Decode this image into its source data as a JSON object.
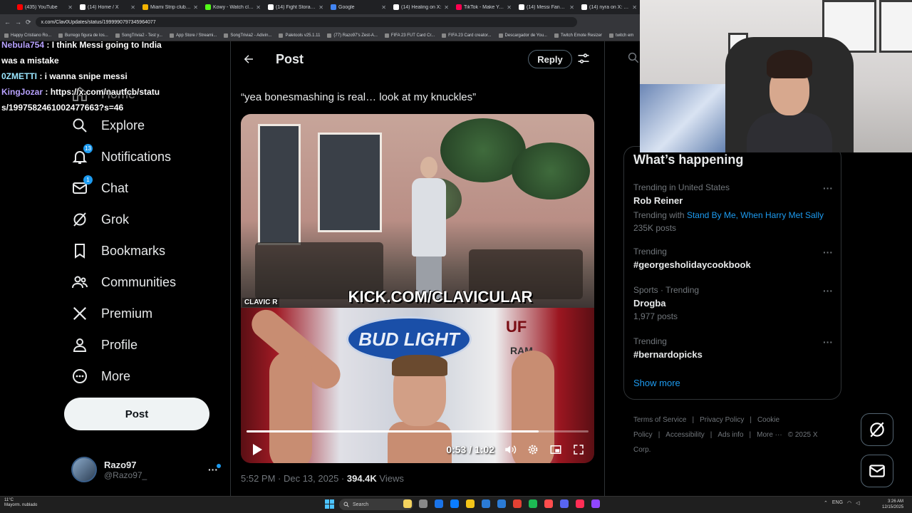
{
  "browser": {
    "tabs": [
      {
        "label": "(435) YouTube",
        "color": "#ff0000"
      },
      {
        "label": "(14) Home / X",
        "color": "#ffffff"
      },
      {
        "label": "Miami Strip clubs, U",
        "color": "#f4b400"
      },
      {
        "label": "Kowy - Watch clips",
        "color": "#53fc18"
      },
      {
        "label": "(14) Fight Storage o",
        "color": "#ffffff"
      },
      {
        "label": "Google",
        "color": "#4285f4"
      },
      {
        "label": "(14) Healing on X:",
        "color": "#ffffff"
      },
      {
        "label": "TikTok - Make Your",
        "color": "#ff0050"
      },
      {
        "label": "(14) Messi Fanatic o",
        "color": "#ffffff"
      },
      {
        "label": "(14) nyra on X: \"the",
        "color": "#ffffff"
      }
    ],
    "url": "x.com/Clav0Updates/status/1999990797345964077",
    "bookmarks": [
      "Happy Cristiano Ro...",
      "Burrego figura de los...",
      "SongTrivia2 - Test y...",
      "App Store / Streami...",
      "SongTrivia2 - Adivin...",
      "Paletools v25.1.11",
      "(77) Razo97's Zest-A...",
      "FIFA 23 FUT Card Cr...",
      "FIFA 23 Card creator...",
      "Descargador de You...",
      "Twitch Emote Resizer",
      "twitch em"
    ]
  },
  "chat": [
    {
      "user": "Nebula754",
      "text": ": I think Messi going to India was a mistake"
    },
    {
      "user": "0ZMETTI",
      "text": ": i wanna snipe messi"
    },
    {
      "user": "KingJozar",
      "text": ": https://x.com/nautfcb/status/1997582461002477663?s=46"
    }
  ],
  "sidebar": {
    "items": [
      {
        "label": "Home",
        "icon": "home-icon"
      },
      {
        "label": "Explore",
        "icon": "search-icon"
      },
      {
        "label": "Notifications",
        "icon": "bell-icon",
        "badge": "13"
      },
      {
        "label": "Chat",
        "icon": "mail-icon",
        "badge": "1"
      },
      {
        "label": "Grok",
        "icon": "grok-icon"
      },
      {
        "label": "Bookmarks",
        "icon": "bookmark-icon"
      },
      {
        "label": "Communities",
        "icon": "people-icon"
      },
      {
        "label": "Premium",
        "icon": "x-logo-icon"
      },
      {
        "label": "Profile",
        "icon": "person-icon"
      },
      {
        "label": "More",
        "icon": "more-circle-icon"
      }
    ],
    "post_label": "Post",
    "account": {
      "name": "Razo97",
      "handle": "@Razo97_"
    }
  },
  "post": {
    "header_title": "Post",
    "reply_label": "Reply",
    "text": "“yea bonesmashing is real… look at my knuckles”",
    "video": {
      "overlay_text": "KICK.COM/CLAVICULAR",
      "overlay_small": "CLAVIC    R",
      "banner_text": "BUD LIGHT",
      "banner_side": "UF",
      "banner_side2": "RAM",
      "time": "0:53 / 1:02",
      "progress": 0.855
    },
    "timestamp": "5:52 PM · Dec 13, 2025 · ",
    "views_count": "394.4K",
    "views_label": " Views"
  },
  "trending": {
    "title": "What’s happening",
    "items": [
      {
        "context": "Trending in United States",
        "name": "Rob Reiner",
        "with_label": "Trending with ",
        "with_links": "Stand By Me, When Harry Met Sally",
        "count": "235K posts"
      },
      {
        "context": "Trending",
        "name": "#georgesholidaycookbook"
      },
      {
        "context": "Sports · Trending",
        "name": "Drogba",
        "count": "1,977 posts"
      },
      {
        "context": "Trending",
        "name": "#bernardopicks"
      }
    ],
    "show_more": "Show more"
  },
  "footer": {
    "links": [
      "Terms of Service",
      "|",
      "Privacy Policy",
      "|",
      "Cookie Policy",
      "|",
      "Accessibility",
      "|",
      "Ads info",
      "|",
      "More ···",
      "© 2025 X Corp."
    ]
  },
  "taskbar": {
    "weather_temp": "11°C",
    "weather_desc": "Mayorm. nublado",
    "search_label": "Search",
    "lang": "ENG",
    "time": "3:26 AM",
    "date": "12/15/2025"
  },
  "colors": {
    "accent": "#1d9bf0",
    "background": "#000000",
    "muted": "#71767b",
    "text": "#e7e9ea"
  }
}
